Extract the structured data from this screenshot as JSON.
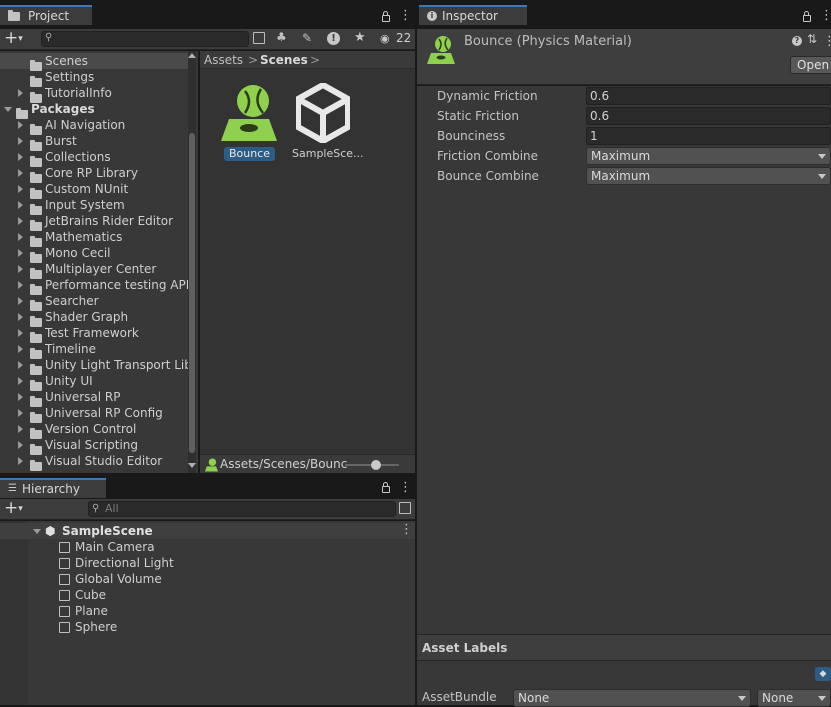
{
  "project": {
    "tab_label": "Project",
    "search_placeholder": "",
    "visible_count": "22",
    "tree": [
      {
        "label": "Scenes",
        "indent": 1,
        "arrow": "none",
        "selected": true
      },
      {
        "label": "Settings",
        "indent": 1,
        "arrow": "none"
      },
      {
        "label": "TutorialInfo",
        "indent": 1,
        "arrow": "right"
      },
      {
        "label": "Packages",
        "indent": 0,
        "arrow": "down",
        "bold": true
      },
      {
        "label": "AI Navigation",
        "indent": 1,
        "arrow": "right"
      },
      {
        "label": "Burst",
        "indent": 1,
        "arrow": "right"
      },
      {
        "label": "Collections",
        "indent": 1,
        "arrow": "right"
      },
      {
        "label": "Core RP Library",
        "indent": 1,
        "arrow": "right"
      },
      {
        "label": "Custom NUnit",
        "indent": 1,
        "arrow": "right"
      },
      {
        "label": "Input System",
        "indent": 1,
        "arrow": "right"
      },
      {
        "label": "JetBrains Rider Editor",
        "indent": 1,
        "arrow": "right"
      },
      {
        "label": "Mathematics",
        "indent": 1,
        "arrow": "right"
      },
      {
        "label": "Mono Cecil",
        "indent": 1,
        "arrow": "right"
      },
      {
        "label": "Multiplayer Center",
        "indent": 1,
        "arrow": "right"
      },
      {
        "label": "Performance testing API",
        "indent": 1,
        "arrow": "right"
      },
      {
        "label": "Searcher",
        "indent": 1,
        "arrow": "right"
      },
      {
        "label": "Shader Graph",
        "indent": 1,
        "arrow": "right"
      },
      {
        "label": "Test Framework",
        "indent": 1,
        "arrow": "right"
      },
      {
        "label": "Timeline",
        "indent": 1,
        "arrow": "right"
      },
      {
        "label": "Unity Light Transport Lib",
        "indent": 1,
        "arrow": "right"
      },
      {
        "label": "Unity UI",
        "indent": 1,
        "arrow": "right"
      },
      {
        "label": "Universal RP",
        "indent": 1,
        "arrow": "right"
      },
      {
        "label": "Universal RP Config",
        "indent": 1,
        "arrow": "right"
      },
      {
        "label": "Version Control",
        "indent": 1,
        "arrow": "right"
      },
      {
        "label": "Visual Scripting",
        "indent": 1,
        "arrow": "right"
      },
      {
        "label": "Visual Studio Editor",
        "indent": 1,
        "arrow": "right"
      }
    ],
    "breadcrumb": [
      "Assets",
      "Scenes"
    ],
    "assets": [
      {
        "label": "Bounce",
        "icon": "physics-material-icon",
        "selected": true
      },
      {
        "label": "SampleSce...",
        "icon": "unity-scene-icon",
        "selected": false
      }
    ],
    "status_path": "Assets/Scenes/Bounc"
  },
  "hierarchy": {
    "tab_label": "Hierarchy",
    "search_placeholder": "All",
    "scene": "SampleScene",
    "objects": [
      "Main Camera",
      "Directional Light",
      "Global Volume",
      "Cube",
      "Plane",
      "Sphere"
    ]
  },
  "inspector": {
    "tab_label": "Inspector",
    "title": "Bounce (Physics Material)",
    "open_label": "Open",
    "props": [
      {
        "label": "Dynamic Friction",
        "value": "0.6",
        "kind": "field"
      },
      {
        "label": "Static Friction",
        "value": "0.6",
        "kind": "field"
      },
      {
        "label": "Bounciness",
        "value": "1",
        "kind": "field"
      },
      {
        "label": "Friction Combine",
        "value": "Maximum",
        "kind": "dropdown"
      },
      {
        "label": "Bounce Combine",
        "value": "Maximum",
        "kind": "dropdown"
      }
    ],
    "asset_labels_title": "Asset Labels",
    "asset_bundle_label": "AssetBundle",
    "asset_bundle_value": "None",
    "asset_bundle_variant": "None"
  },
  "colors": {
    "accent": "#3a79bb",
    "selection": "#2c5d87",
    "physics_green": "#8fd14f"
  }
}
